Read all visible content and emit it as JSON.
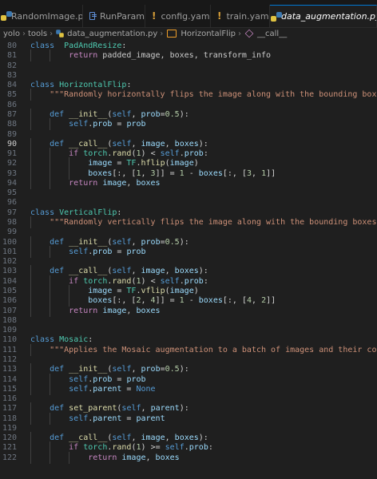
{
  "tabs": [
    {
      "name": "RandomImage.py",
      "icon": "python-file-icon",
      "active": false,
      "modified": true
    },
    {
      "name": "RunParam",
      "icon": "run-param-icon",
      "active": false,
      "modified": false
    },
    {
      "name": "config.yaml",
      "icon": "yaml-file-icon",
      "active": false,
      "modified": false
    },
    {
      "name": "train.yaml",
      "icon": "yaml-file-icon",
      "active": false,
      "modified": false
    },
    {
      "name": "data_augmentation.py",
      "icon": "python-file-icon",
      "active": true,
      "modified": false
    }
  ],
  "breadcrumb": [
    "yolo",
    "tools",
    "data_augmentation.py",
    "HorizontalFlip",
    "__call__"
  ],
  "editor": {
    "current_line": 90,
    "lines": [
      {
        "n": 80,
        "indent": 0,
        "tokens": [
          [
            "kw",
            "class"
          ],
          [
            "",
            "  "
          ],
          [
            "cls",
            "PadAndResize"
          ],
          [
            "op",
            ":"
          ]
        ]
      },
      {
        "n": 81,
        "indent": 2,
        "tokens": [
          [
            "ctl",
            "return"
          ],
          [
            "",
            " padded_image, boxes, transform_info"
          ]
        ]
      },
      {
        "n": 82,
        "indent": 0,
        "tokens": []
      },
      {
        "n": 83,
        "indent": 0,
        "tokens": []
      },
      {
        "n": 84,
        "indent": 0,
        "tokens": [
          [
            "kw",
            "class"
          ],
          [
            "",
            " "
          ],
          [
            "cls",
            "HorizontalFlip"
          ],
          [
            "op",
            ":"
          ]
        ]
      },
      {
        "n": 85,
        "indent": 1,
        "tokens": [
          [
            "str",
            "\"\"\"Randomly horizontally flips the image along with the bounding boxes.\"\"\""
          ]
        ]
      },
      {
        "n": 86,
        "indent": 0,
        "tokens": []
      },
      {
        "n": 87,
        "indent": 1,
        "tokens": [
          [
            "kw",
            "def"
          ],
          [
            "",
            " "
          ],
          [
            "fn",
            "__init__"
          ],
          [
            "op",
            "("
          ],
          [
            "self",
            "self"
          ],
          [
            "op",
            ", "
          ],
          [
            "var",
            "prob"
          ],
          [
            "op",
            "="
          ],
          [
            "num",
            "0.5"
          ],
          [
            "op",
            "):"
          ]
        ]
      },
      {
        "n": 88,
        "indent": 2,
        "tokens": [
          [
            "self",
            "self"
          ],
          [
            "op",
            "."
          ],
          [
            "var",
            "prob"
          ],
          [
            "op",
            " = "
          ],
          [
            "var",
            "prob"
          ]
        ]
      },
      {
        "n": 89,
        "indent": 0,
        "tokens": []
      },
      {
        "n": 90,
        "indent": 1,
        "tokens": [
          [
            "kw",
            "def"
          ],
          [
            "",
            " "
          ],
          [
            "fn",
            "__call__"
          ],
          [
            "op",
            "("
          ],
          [
            "self",
            "self"
          ],
          [
            "op",
            ", "
          ],
          [
            "var",
            "image"
          ],
          [
            "op",
            ", "
          ],
          [
            "var",
            "boxes"
          ],
          [
            "op",
            "):"
          ]
        ]
      },
      {
        "n": 91,
        "indent": 2,
        "tokens": [
          [
            "ctl",
            "if"
          ],
          [
            "",
            " "
          ],
          [
            "cls",
            "torch"
          ],
          [
            "op",
            "."
          ],
          [
            "fn",
            "rand"
          ],
          [
            "op",
            "("
          ],
          [
            "num",
            "1"
          ],
          [
            "op",
            ") < "
          ],
          [
            "self",
            "self"
          ],
          [
            "op",
            "."
          ],
          [
            "var",
            "prob"
          ],
          [
            "op",
            ":"
          ]
        ]
      },
      {
        "n": 92,
        "indent": 3,
        "tokens": [
          [
            "var",
            "image"
          ],
          [
            "op",
            " = "
          ],
          [
            "cls",
            "TF"
          ],
          [
            "op",
            "."
          ],
          [
            "fn",
            "hflip"
          ],
          [
            "op",
            "("
          ],
          [
            "var",
            "image"
          ],
          [
            "op",
            ")"
          ]
        ]
      },
      {
        "n": 93,
        "indent": 3,
        "tokens": [
          [
            "var",
            "boxes"
          ],
          [
            "op",
            "[:, ["
          ],
          [
            "num",
            "1"
          ],
          [
            "op",
            ", "
          ],
          [
            "num",
            "3"
          ],
          [
            "op",
            "]] = "
          ],
          [
            "num",
            "1"
          ],
          [
            "op",
            " - "
          ],
          [
            "var",
            "boxes"
          ],
          [
            "op",
            "[:, ["
          ],
          [
            "num",
            "3"
          ],
          [
            "op",
            ", "
          ],
          [
            "num",
            "1"
          ],
          [
            "op",
            "]]"
          ]
        ]
      },
      {
        "n": 94,
        "indent": 2,
        "tokens": [
          [
            "ctl",
            "return"
          ],
          [
            "",
            " "
          ],
          [
            "var",
            "image"
          ],
          [
            "op",
            ", "
          ],
          [
            "var",
            "boxes"
          ]
        ]
      },
      {
        "n": 95,
        "indent": 0,
        "tokens": []
      },
      {
        "n": 96,
        "indent": 0,
        "tokens": []
      },
      {
        "n": 97,
        "indent": 0,
        "tokens": [
          [
            "kw",
            "class"
          ],
          [
            "",
            " "
          ],
          [
            "cls",
            "VerticalFlip"
          ],
          [
            "op",
            ":"
          ]
        ]
      },
      {
        "n": 98,
        "indent": 1,
        "tokens": [
          [
            "str",
            "\"\"\"Randomly vertically flips the image along with the bounding boxes.\"\"\""
          ]
        ]
      },
      {
        "n": 99,
        "indent": 0,
        "tokens": []
      },
      {
        "n": 100,
        "indent": 1,
        "tokens": [
          [
            "kw",
            "def"
          ],
          [
            "",
            " "
          ],
          [
            "fn",
            "__init__"
          ],
          [
            "op",
            "("
          ],
          [
            "self",
            "self"
          ],
          [
            "op",
            ", "
          ],
          [
            "var",
            "prob"
          ],
          [
            "op",
            "="
          ],
          [
            "num",
            "0.5"
          ],
          [
            "op",
            "):"
          ]
        ]
      },
      {
        "n": 101,
        "indent": 2,
        "tokens": [
          [
            "self",
            "self"
          ],
          [
            "op",
            "."
          ],
          [
            "var",
            "prob"
          ],
          [
            "op",
            " = "
          ],
          [
            "var",
            "prob"
          ]
        ]
      },
      {
        "n": 102,
        "indent": 0,
        "tokens": []
      },
      {
        "n": 103,
        "indent": 1,
        "tokens": [
          [
            "kw",
            "def"
          ],
          [
            "",
            " "
          ],
          [
            "fn",
            "__call__"
          ],
          [
            "op",
            "("
          ],
          [
            "self",
            "self"
          ],
          [
            "op",
            ", "
          ],
          [
            "var",
            "image"
          ],
          [
            "op",
            ", "
          ],
          [
            "var",
            "boxes"
          ],
          [
            "op",
            "):"
          ]
        ]
      },
      {
        "n": 104,
        "indent": 2,
        "tokens": [
          [
            "ctl",
            "if"
          ],
          [
            "",
            " "
          ],
          [
            "cls",
            "torch"
          ],
          [
            "op",
            "."
          ],
          [
            "fn",
            "rand"
          ],
          [
            "op",
            "("
          ],
          [
            "num",
            "1"
          ],
          [
            "op",
            ") < "
          ],
          [
            "self",
            "self"
          ],
          [
            "op",
            "."
          ],
          [
            "var",
            "prob"
          ],
          [
            "op",
            ":"
          ]
        ]
      },
      {
        "n": 105,
        "indent": 3,
        "tokens": [
          [
            "var",
            "image"
          ],
          [
            "op",
            " = "
          ],
          [
            "cls",
            "TF"
          ],
          [
            "op",
            "."
          ],
          [
            "fn",
            "vflip"
          ],
          [
            "op",
            "("
          ],
          [
            "var",
            "image"
          ],
          [
            "op",
            ")"
          ]
        ]
      },
      {
        "n": 106,
        "indent": 3,
        "tokens": [
          [
            "var",
            "boxes"
          ],
          [
            "op",
            "[:, ["
          ],
          [
            "num",
            "2"
          ],
          [
            "op",
            ", "
          ],
          [
            "num",
            "4"
          ],
          [
            "op",
            "]] = "
          ],
          [
            "num",
            "1"
          ],
          [
            "op",
            " - "
          ],
          [
            "var",
            "boxes"
          ],
          [
            "op",
            "[:, ["
          ],
          [
            "num",
            "4"
          ],
          [
            "op",
            ", "
          ],
          [
            "num",
            "2"
          ],
          [
            "op",
            "]]"
          ]
        ]
      },
      {
        "n": 107,
        "indent": 2,
        "tokens": [
          [
            "ctl",
            "return"
          ],
          [
            "",
            " "
          ],
          [
            "var",
            "image"
          ],
          [
            "op",
            ", "
          ],
          [
            "var",
            "boxes"
          ]
        ]
      },
      {
        "n": 108,
        "indent": 0,
        "tokens": []
      },
      {
        "n": 109,
        "indent": 0,
        "tokens": []
      },
      {
        "n": 110,
        "indent": 0,
        "tokens": [
          [
            "kw",
            "class"
          ],
          [
            "",
            " "
          ],
          [
            "cls",
            "Mosaic"
          ],
          [
            "op",
            ":"
          ]
        ]
      },
      {
        "n": 111,
        "indent": 1,
        "tokens": [
          [
            "str",
            "\"\"\"Applies the Mosaic augmentation to a batch of images and their corresponding bo"
          ]
        ]
      },
      {
        "n": 112,
        "indent": 0,
        "tokens": []
      },
      {
        "n": 113,
        "indent": 1,
        "tokens": [
          [
            "kw",
            "def"
          ],
          [
            "",
            " "
          ],
          [
            "fn",
            "__init__"
          ],
          [
            "op",
            "("
          ],
          [
            "self",
            "self"
          ],
          [
            "op",
            ", "
          ],
          [
            "var",
            "prob"
          ],
          [
            "op",
            "="
          ],
          [
            "num",
            "0.5"
          ],
          [
            "op",
            "):"
          ]
        ]
      },
      {
        "n": 114,
        "indent": 2,
        "tokens": [
          [
            "self",
            "self"
          ],
          [
            "op",
            "."
          ],
          [
            "var",
            "prob"
          ],
          [
            "op",
            " = "
          ],
          [
            "var",
            "prob"
          ]
        ]
      },
      {
        "n": 115,
        "indent": 2,
        "tokens": [
          [
            "self",
            "self"
          ],
          [
            "op",
            "."
          ],
          [
            "var",
            "parent"
          ],
          [
            "op",
            " = "
          ],
          [
            "kw",
            "None"
          ]
        ]
      },
      {
        "n": 116,
        "indent": 0,
        "tokens": []
      },
      {
        "n": 117,
        "indent": 1,
        "tokens": [
          [
            "kw",
            "def"
          ],
          [
            "",
            " "
          ],
          [
            "fn",
            "set_parent"
          ],
          [
            "op",
            "("
          ],
          [
            "self",
            "self"
          ],
          [
            "op",
            ", "
          ],
          [
            "var",
            "parent"
          ],
          [
            "op",
            "):"
          ]
        ]
      },
      {
        "n": 118,
        "indent": 2,
        "tokens": [
          [
            "self",
            "self"
          ],
          [
            "op",
            "."
          ],
          [
            "var",
            "parent"
          ],
          [
            "op",
            " = "
          ],
          [
            "var",
            "parent"
          ]
        ]
      },
      {
        "n": 119,
        "indent": 0,
        "tokens": []
      },
      {
        "n": 120,
        "indent": 1,
        "tokens": [
          [
            "kw",
            "def"
          ],
          [
            "",
            " "
          ],
          [
            "fn",
            "__call__"
          ],
          [
            "op",
            "("
          ],
          [
            "self",
            "self"
          ],
          [
            "op",
            ", "
          ],
          [
            "var",
            "image"
          ],
          [
            "op",
            ", "
          ],
          [
            "var",
            "boxes"
          ],
          [
            "op",
            "):"
          ]
        ]
      },
      {
        "n": 121,
        "indent": 2,
        "tokens": [
          [
            "ctl",
            "if"
          ],
          [
            "",
            " "
          ],
          [
            "cls",
            "torch"
          ],
          [
            "op",
            "."
          ],
          [
            "fn",
            "rand"
          ],
          [
            "op",
            "("
          ],
          [
            "num",
            "1"
          ],
          [
            "op",
            ") >= "
          ],
          [
            "self",
            "self"
          ],
          [
            "op",
            "."
          ],
          [
            "var",
            "prob"
          ],
          [
            "op",
            ":"
          ]
        ]
      },
      {
        "n": 122,
        "indent": 3,
        "tokens": [
          [
            "ctl",
            "return"
          ],
          [
            "",
            " "
          ],
          [
            "var",
            "image"
          ],
          [
            "op",
            ", "
          ],
          [
            "var",
            "boxes"
          ]
        ]
      }
    ]
  }
}
